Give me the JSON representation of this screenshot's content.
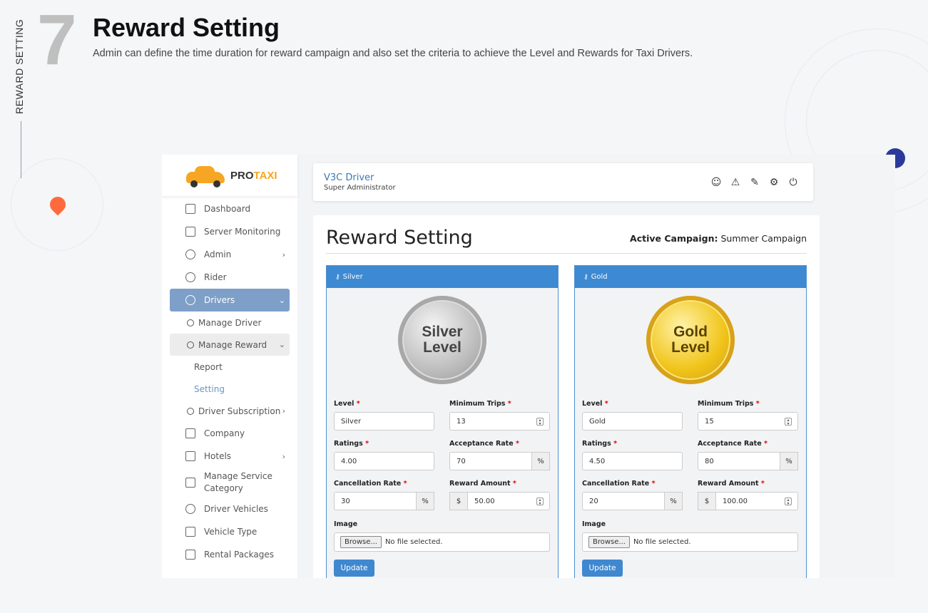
{
  "hero": {
    "number": "7",
    "vertical_label": "REWARD SETTING",
    "title": "Reward Setting",
    "subtitle": "Admin can define the time duration for reward campaign and also set the criteria to achieve the Level and Rewards for Taxi Drivers."
  },
  "logo": {
    "pro": "PRO",
    "taxi": "TAXI"
  },
  "sidebar": {
    "items": [
      {
        "label": "Dashboard",
        "icon": "dashboard-icon"
      },
      {
        "label": "Server Monitoring",
        "icon": "chart-icon"
      },
      {
        "label": "Admin",
        "icon": "user-icon",
        "chevron": "›"
      },
      {
        "label": "Rider",
        "icon": "riders-icon"
      },
      {
        "label": "Drivers",
        "icon": "driver-icon",
        "chevron": "⌄"
      }
    ],
    "manage_driver": "Manage Driver",
    "manage_reward": "Manage Reward",
    "manage_reward_chevron": "⌄",
    "report": "Report",
    "setting": "Setting",
    "driver_subscription": "Driver Subscription",
    "company": "Company",
    "hotels": "Hotels",
    "manage_service_category": "Manage Service Category",
    "driver_vehicles": "Driver Vehicles",
    "vehicle_type": "Vehicle Type",
    "rental_packages": "Rental Packages",
    "chevron_right": "›"
  },
  "topbar": {
    "name": "V3C Driver",
    "role": "Super Administrator"
  },
  "content": {
    "title": "Reward Setting",
    "campaign_label": "Active Campaign:",
    "campaign_value": "Summer Campaign"
  },
  "labels": {
    "level": "Level",
    "min_trips": "Minimum Trips",
    "ratings": "Ratings",
    "acceptance": "Acceptance Rate",
    "cancellation": "Cancellation Rate",
    "reward_amount": "Reward Amount",
    "image": "Image",
    "required": "*",
    "percent": "%",
    "currency": "$",
    "browse": "Browse...",
    "no_file": "No file selected.",
    "update": "Update"
  },
  "panels": [
    {
      "title": "Silver",
      "coin_line1": "Silver",
      "coin_line2": "Level",
      "level": "Silver",
      "min_trips": "13",
      "ratings": "4.00",
      "acceptance": "70",
      "cancellation": "30",
      "reward_amount": "50.00"
    },
    {
      "title": "Gold",
      "coin_line1": "Gold",
      "coin_line2": "Level",
      "level": "Gold",
      "min_trips": "15",
      "ratings": "4.50",
      "acceptance": "80",
      "cancellation": "20",
      "reward_amount": "100.00"
    }
  ],
  "colors": {
    "accent": "#3d89d2",
    "sidebar_active": "#7e9fc7",
    "brand_orange": "#f6a623"
  }
}
